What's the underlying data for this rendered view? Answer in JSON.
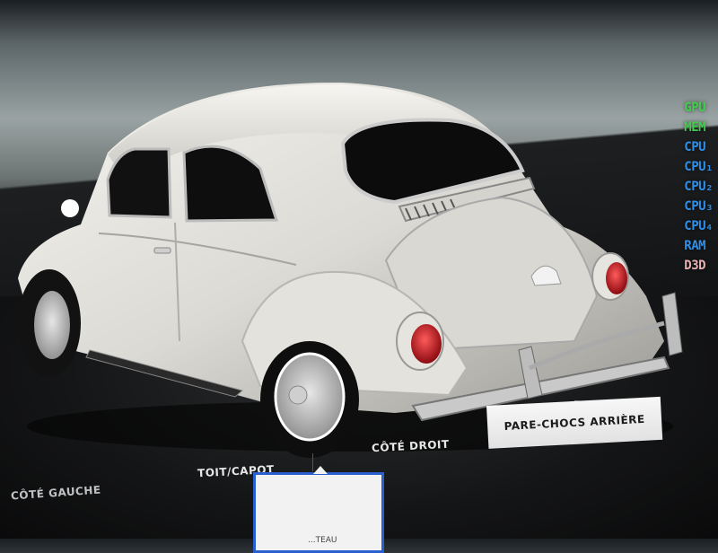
{
  "perf_overlay": [
    {
      "label": "GPU",
      "color": "#3fcf4a"
    },
    {
      "label": "MEM",
      "color": "#3fcf4a"
    },
    {
      "label": "CPU",
      "color": "#2f8fe8"
    },
    {
      "label": "CPU₁",
      "color": "#2f8fe8"
    },
    {
      "label": "CPU₂",
      "color": "#2f8fe8"
    },
    {
      "label": "CPU₃",
      "color": "#2f8fe8"
    },
    {
      "label": "CPU₄",
      "color": "#2f8fe8"
    },
    {
      "label": "RAM",
      "color": "#2f8fe8"
    },
    {
      "label": "D3D",
      "color": "#e8b0b0"
    }
  ],
  "menu": {
    "left_side": "CÔTÉ GAUCHE",
    "roof_hood": "TOIT/CAPOT",
    "right_side": "CÔTÉ DROIT",
    "selected": "PARE-CHOCS ARRIÈRE",
    "card_text": "...TEAU"
  },
  "colors": {
    "accent": "#2a5fd0",
    "car_body": "#e9e7e2",
    "taillight": "#d0141c"
  }
}
